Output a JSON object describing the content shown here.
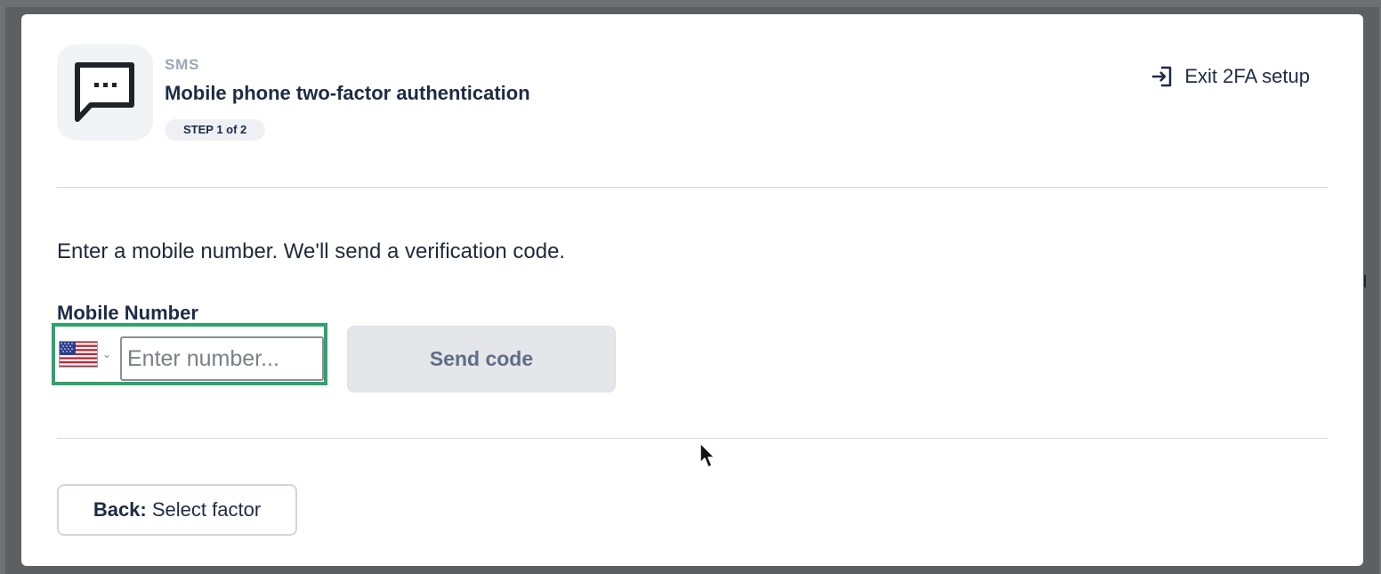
{
  "factor": {
    "kind_label": "SMS",
    "title": "Mobile phone two-factor authentication",
    "step_badge": "STEP 1 of 2",
    "icon": "sms-bubble-icon"
  },
  "header": {
    "exit_label": "Exit 2FA setup",
    "exit_icon": "exit-arrow-icon"
  },
  "body": {
    "instructions": "Enter a mobile number. We'll send a verification code.",
    "field_label": "Mobile Number",
    "country": {
      "selected": "United States",
      "icon": "us-flag-icon"
    },
    "phone_input": {
      "value": "",
      "placeholder": "Enter number..."
    },
    "send_button_label": "Send code"
  },
  "footer": {
    "back_prefix": "Back:",
    "back_label": "Select factor"
  },
  "colors": {
    "highlight": "#2ea36c",
    "text_dark": "#1d2b45",
    "muted": "#9ba6b7",
    "button_disabled_bg": "#e4e6ea"
  }
}
